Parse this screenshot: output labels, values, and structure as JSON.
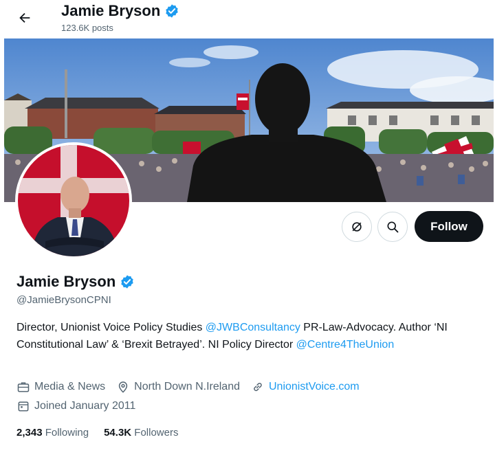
{
  "header": {
    "name": "Jamie Bryson",
    "posts": "123.6K posts"
  },
  "actions": {
    "follow_label": "Follow"
  },
  "profile": {
    "name": "Jamie Bryson",
    "handle": "@JamieBrysonCPNI",
    "bio": {
      "part1": "Director, Unionist Voice Policy Studies ",
      "mention1": "@JWBConsultancy",
      "part2": " PR-Law-Advocacy. Author ‘NI Constitutional Law’ & ‘Brexit Betrayed’. NI Policy Director ",
      "mention2": "@Centre4TheUnion"
    },
    "category": "Media & News",
    "location": "North Down N.Ireland",
    "website": "UnionistVoice.com",
    "joined": "Joined January 2011"
  },
  "stats": {
    "following_count": "2,343",
    "following_label": "Following",
    "followers_count": "54.3K",
    "followers_label": "Followers"
  },
  "colors": {
    "accent": "#1d9bf0",
    "text": "#0f1419",
    "muted": "#536471",
    "follow_bg": "#0f1419"
  },
  "icons": [
    "back-arrow-icon",
    "verified-badge-icon",
    "more-options-icon",
    "search-icon",
    "briefcase-icon",
    "location-pin-icon",
    "link-icon",
    "calendar-icon"
  ]
}
